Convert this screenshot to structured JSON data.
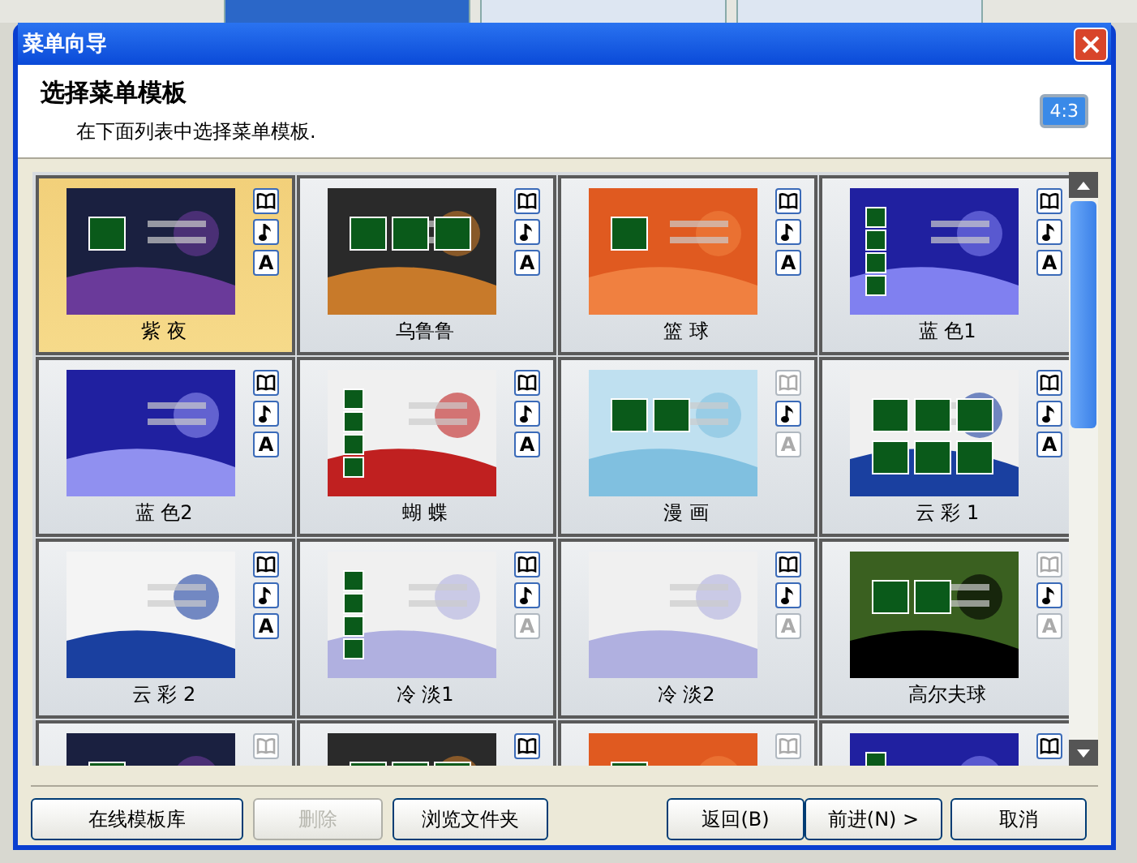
{
  "app_tabs": [
    {
      "selected": true
    },
    {
      "selected": false
    },
    {
      "selected": false
    }
  ],
  "window": {
    "title": "菜单向导"
  },
  "header": {
    "title": "选择菜单模板",
    "subtitle": "在下面列表中选择菜单模板.",
    "aspect_button": "4:3"
  },
  "templates": [
    {
      "label": "紫 夜",
      "selected": true,
      "icons": [
        {
          "kind": "book",
          "enabled": true
        },
        {
          "kind": "music",
          "enabled": true
        },
        {
          "kind": "text",
          "glyph": "A",
          "enabled": true
        }
      ]
    },
    {
      "label": "乌鲁鲁",
      "selected": false,
      "icons": [
        {
          "kind": "book",
          "enabled": true
        },
        {
          "kind": "music",
          "enabled": true
        },
        {
          "kind": "text",
          "glyph": "A",
          "enabled": true
        }
      ]
    },
    {
      "label": "篮 球",
      "selected": false,
      "icons": [
        {
          "kind": "book",
          "enabled": true
        },
        {
          "kind": "music",
          "enabled": true
        },
        {
          "kind": "text",
          "glyph": "A",
          "enabled": true
        }
      ]
    },
    {
      "label": "蓝 色1",
      "selected": false,
      "icons": [
        {
          "kind": "book",
          "enabled": true
        },
        {
          "kind": "music",
          "enabled": true
        },
        {
          "kind": "text",
          "glyph": "A",
          "enabled": true
        }
      ]
    },
    {
      "label": "蓝 色2",
      "selected": false,
      "icons": [
        {
          "kind": "book",
          "enabled": true
        },
        {
          "kind": "music",
          "enabled": true
        },
        {
          "kind": "text",
          "glyph": "A",
          "enabled": true
        }
      ]
    },
    {
      "label": "蝴 蝶",
      "selected": false,
      "icons": [
        {
          "kind": "book",
          "enabled": true
        },
        {
          "kind": "music",
          "enabled": true
        },
        {
          "kind": "text",
          "glyph": "A",
          "enabled": true
        }
      ]
    },
    {
      "label": "漫 画",
      "selected": false,
      "icons": [
        {
          "kind": "book",
          "enabled": false
        },
        {
          "kind": "music",
          "enabled": true
        },
        {
          "kind": "text",
          "glyph": "A",
          "enabled": false
        }
      ]
    },
    {
      "label": "云 彩 1",
      "selected": false,
      "icons": [
        {
          "kind": "book",
          "enabled": true
        },
        {
          "kind": "music",
          "enabled": true
        },
        {
          "kind": "text",
          "glyph": "A",
          "enabled": true
        }
      ]
    },
    {
      "label": "云 彩 2",
      "selected": false,
      "icons": [
        {
          "kind": "book",
          "enabled": true
        },
        {
          "kind": "music",
          "enabled": true
        },
        {
          "kind": "text",
          "glyph": "A",
          "enabled": true
        }
      ]
    },
    {
      "label": "冷 淡1",
      "selected": false,
      "icons": [
        {
          "kind": "book",
          "enabled": true
        },
        {
          "kind": "music",
          "enabled": true
        },
        {
          "kind": "text",
          "glyph": "A",
          "enabled": false
        }
      ]
    },
    {
      "label": "冷 淡2",
      "selected": false,
      "icons": [
        {
          "kind": "book",
          "enabled": true
        },
        {
          "kind": "music",
          "enabled": true
        },
        {
          "kind": "text",
          "glyph": "A",
          "enabled": false
        }
      ]
    },
    {
      "label": "高尔夫球",
      "selected": false,
      "icons": [
        {
          "kind": "book",
          "enabled": false
        },
        {
          "kind": "music",
          "enabled": true
        },
        {
          "kind": "text",
          "glyph": "A",
          "enabled": false
        }
      ]
    },
    {
      "selected": false,
      "icons": [
        {
          "kind": "book",
          "enabled": false
        }
      ]
    },
    {
      "selected": false,
      "icons": [
        {
          "kind": "book",
          "enabled": true
        }
      ]
    },
    {
      "selected": false,
      "icons": [
        {
          "kind": "book",
          "enabled": false
        }
      ]
    },
    {
      "selected": false,
      "icons": [
        {
          "kind": "book",
          "enabled": true
        }
      ]
    }
  ],
  "buttons": [
    {
      "label": "在线模板库",
      "disabled": false
    },
    {
      "label": "删除",
      "disabled": true
    },
    {
      "label": "浏览文件夹",
      "disabled": false
    }
  ],
  "nav_buttons": [
    {
      "label": "返回(B)",
      "disabled": false
    },
    {
      "label": "前进(N) >",
      "disabled": false
    }
  ],
  "cancel_button": {
    "label": "取消"
  }
}
